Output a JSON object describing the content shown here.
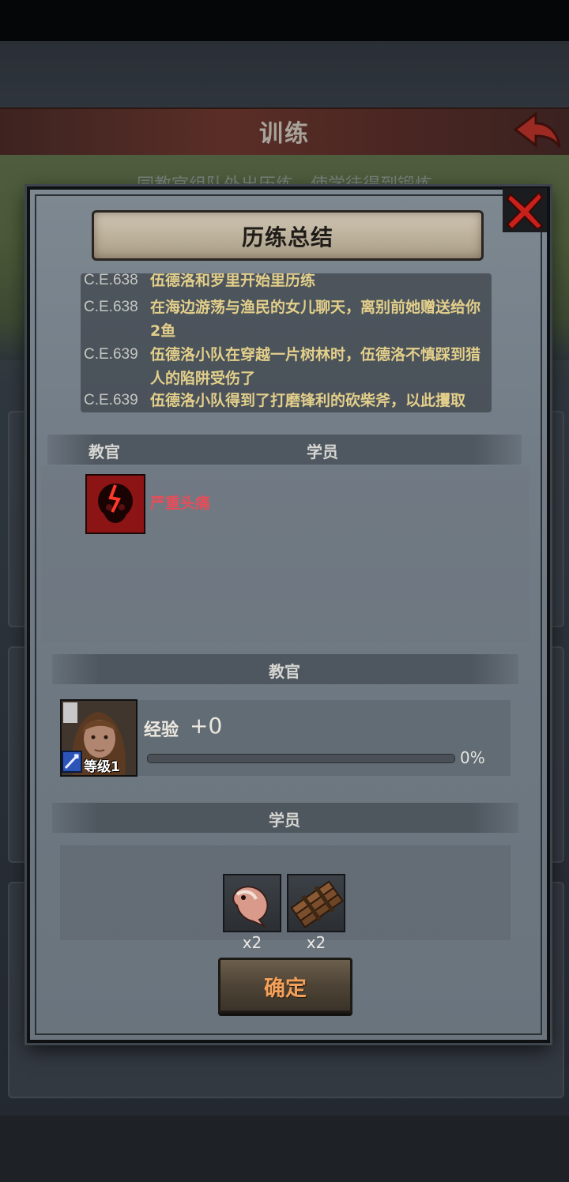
{
  "background": {
    "title": "训练",
    "subtitle": "同教官组队外出历练，使学徒得到锻炼"
  },
  "dialog": {
    "title": "历练总结",
    "log": [
      {
        "date": "C.E.638",
        "text": "伍德洛和罗里开始里历练"
      },
      {
        "date": "C.E.638",
        "text": "在海边游荡与渔民的女儿聊天，离别前她赠送给你2鱼"
      },
      {
        "date": "C.E.639",
        "text": "伍德洛小队在穿越一片树林时，伍德洛不慎踩到猎人的陷阱受伤了"
      },
      {
        "date": "C.E.639",
        "text": "伍德洛小队得到了打磨锋利的砍柴斧，以此攫取"
      }
    ],
    "status_section": {
      "instructor_label": "教官",
      "student_label": "学员",
      "effect": {
        "icon": "headache-skull-icon",
        "text": "严重头痛",
        "color": "#e64d5a"
      }
    },
    "instructor_section": {
      "header": "教官",
      "level": "等级1",
      "exp_label": "经验",
      "exp_gain": "+0",
      "exp_percent_text": "0%",
      "exp_fraction": 0
    },
    "student_section": {
      "header": "学员",
      "rewards": [
        {
          "icon": "fish-icon",
          "count": "x2"
        },
        {
          "icon": "wood-planks-icon",
          "count": "x2"
        }
      ]
    },
    "confirm_label": "确定"
  }
}
